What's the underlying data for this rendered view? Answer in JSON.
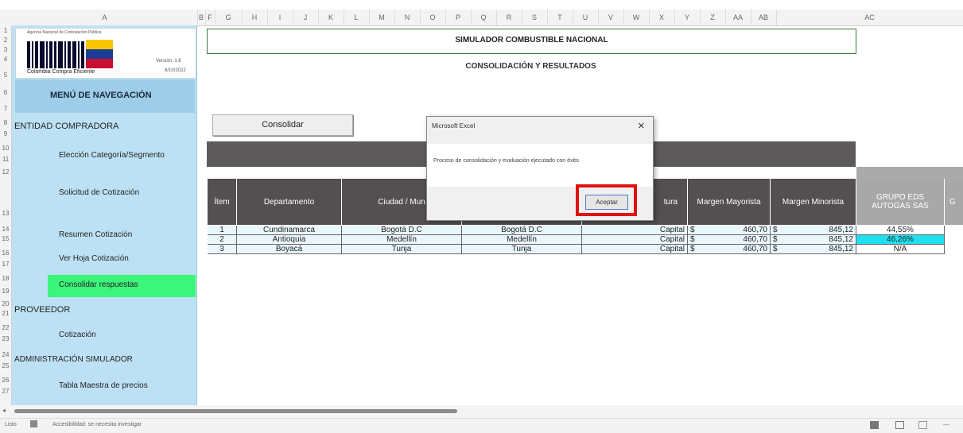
{
  "top_strip_text": "",
  "columns": [
    "A",
    "B",
    "F",
    "G",
    "H",
    "I",
    "J",
    "K",
    "L",
    "M",
    "N",
    "O",
    "P",
    "Q",
    "R",
    "S",
    "T",
    "U",
    "V",
    "W",
    "X",
    "Y",
    "Z",
    "AA",
    "AB",
    "AC"
  ],
  "rows": [
    "1",
    "2",
    "3",
    "4",
    "5",
    "6",
    "7",
    "8",
    "9",
    "10",
    "11",
    "12",
    "13",
    "14",
    "15",
    "16",
    "17",
    "18",
    "19",
    "20",
    "21",
    "22",
    "23",
    "24",
    "25",
    "26",
    "27"
  ],
  "sidebar": {
    "logo_small_text": "Agencia Nacional de Contratación Pública",
    "logo_caption": "Colombia Compra Eficiente",
    "version": "Versión: 1.6",
    "date": "8/10/2022",
    "nav_header": "MENÚ DE NAVEGACIÓN",
    "items": [
      {
        "label": "ENTIDAD COMPRADORA"
      },
      {
        "label": "Elección Categoría/Segmento"
      },
      {
        "label": "Solicitud de Cotización"
      },
      {
        "label": "Resumen Cotización"
      },
      {
        "label": "Ver Hoja Cotización"
      },
      {
        "label": "Consolidar respuestas"
      },
      {
        "label": "PROVEEDOR"
      },
      {
        "label": "Cotización"
      },
      {
        "label": "ADMINISTRACIÓN SIMULADOR"
      },
      {
        "label": "Tabla Maestra de precios"
      }
    ]
  },
  "main": {
    "title": "SIMULADOR COMBUSTIBLE NACIONAL",
    "subtitle": "CONSOLIDACIÓN Y RESULTADOS",
    "consolidate_button": "Consolidar",
    "table_headers": {
      "item": "Ítem",
      "departamento": "Departamento",
      "ciudad": "Ciudad / Mun",
      "estructura": "tura",
      "margen_mayorista": "Margen Mayorista",
      "margen_minorista": "Margen Minorista",
      "grupo_eds": "GRUPO EDS AUTOGAS SAS",
      "next_col": "G"
    },
    "table_rows": [
      {
        "item": "1",
        "departamento": "Cundinamarca",
        "ciudad": "Bogotá D.C",
        "municipio": "Bogotá D.C",
        "estructura": "Capital",
        "cur1": "$",
        "mayorista": "460,70",
        "cur2": "$",
        "minorista": "845,12",
        "grupo": "44,55%"
      },
      {
        "item": "2",
        "departamento": "Antioquia",
        "ciudad": "Medellín",
        "municipio": "Medellín",
        "estructura": "Capital",
        "cur1": "$",
        "mayorista": "460,70",
        "cur2": "$",
        "minorista": "845,12",
        "grupo": "46,26%"
      },
      {
        "item": "3",
        "departamento": "Boyacá",
        "ciudad": "Tunja",
        "municipio": "Tunja",
        "estructura": "Capital",
        "cur1": "$",
        "mayorista": "460,70",
        "cur2": "$",
        "minorista": "845,12",
        "grupo": "N/A"
      }
    ]
  },
  "dialog": {
    "title": "Microsoft Excel",
    "close": "✕",
    "message": "Proceso de consolidación y evaluación ejecutado con éxito",
    "accept": "Aceptar"
  },
  "statusbar": {
    "ready": "Listo",
    "accessibility": "Accesibilidad: se necesita investigar"
  },
  "colors": {
    "sidebar_bg": "#bde1f4",
    "highlight": "#3cf57b",
    "table_header": "#544f50",
    "cyan_cell": "#1fe0f0",
    "red_box": "#e01010"
  }
}
